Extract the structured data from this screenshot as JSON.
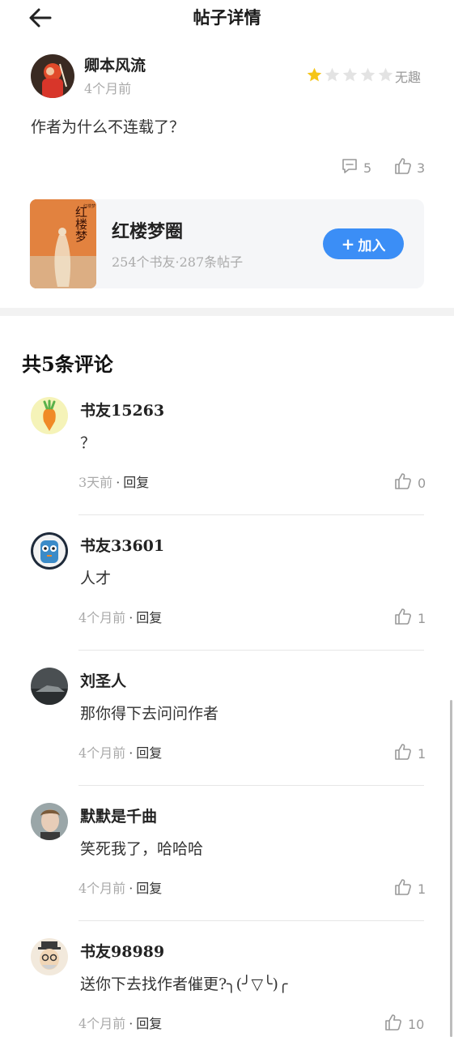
{
  "header": {
    "title": "帖子详情"
  },
  "post": {
    "author": "卿本风流",
    "time": "4个月前",
    "rating_label": "无趣",
    "rating": 1,
    "rating_max": 5,
    "body": "作者为什么不连载了？",
    "comment_count": "5",
    "like_count": "3"
  },
  "circle": {
    "name": "红楼梦圈",
    "stats": "254个书友·287条帖子",
    "join_label": "加入",
    "cover_text": "红楼梦"
  },
  "comments_title": "共5条评论",
  "reply_label": "回复",
  "comments": [
    {
      "name": "书友15263",
      "text": "？",
      "time": "3天前",
      "likes": "0"
    },
    {
      "name": "书友33601",
      "text": "人才",
      "time": "4个月前",
      "likes": "1"
    },
    {
      "name": "刘圣人",
      "text": "那你得下去问问作者",
      "time": "4个月前",
      "likes": "1"
    },
    {
      "name": "默默是千曲",
      "text": "笑死我了，哈哈哈",
      "time": "4个月前",
      "likes": "1"
    },
    {
      "name": "书友98989",
      "text": "送你下去找作者催更?╮(╯▽╰)╭",
      "time": "4个月前",
      "likes": "10"
    }
  ],
  "colors": {
    "accent": "#3b8ef6",
    "star": "#f5c518",
    "star_empty": "#e3e3e3"
  }
}
